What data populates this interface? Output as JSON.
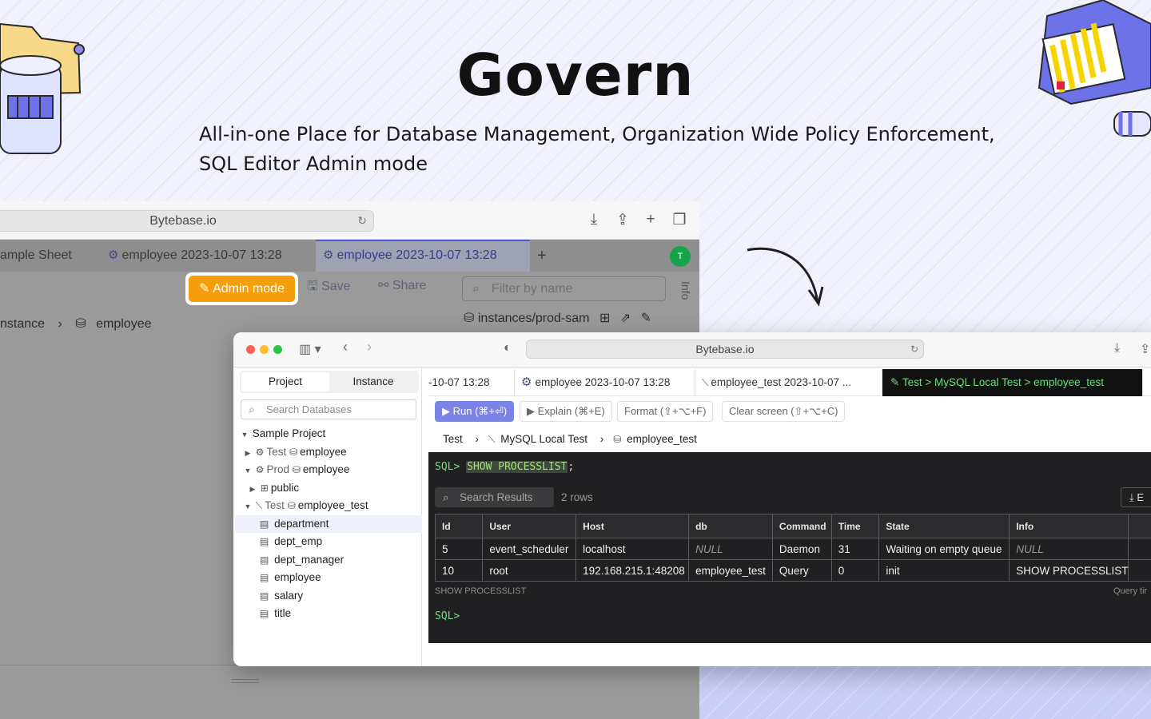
{
  "hero": {
    "title": "Govern",
    "subtitle": "All-in-one Place for Database Management, Organization Wide Policy Enforcement, SQL Editor Admin mode"
  },
  "colors": {
    "accent": "#4f5bd5",
    "admin_orange": "#f59e0b",
    "console_green": "#6fe081",
    "brand_purple": "#7b83e6"
  },
  "back_window": {
    "url": "Bytebase.io",
    "tabs": [
      "ample Sheet",
      "employee 2023-10-07 13:28",
      "employee 2023-10-07 13:28"
    ],
    "avatar": "T",
    "admin_mode_label": "Admin mode",
    "save_label": "Save",
    "share_label": "Share",
    "filter_placeholder": "Filter by name",
    "info_label": "Info",
    "instance_path": "instances/prod-sam",
    "breadcrumb": [
      "nstance",
      "employee"
    ]
  },
  "front_window": {
    "url": "Bytebase.io",
    "sidebar": {
      "tabs": [
        "Project",
        "Instance"
      ],
      "search_placeholder": "Search Databases",
      "project": "Sample Project",
      "rows": [
        {
          "env": "Test",
          "db": "employee"
        },
        {
          "env": "Prod",
          "db": "employee"
        },
        {
          "schema": "public"
        },
        {
          "env": "Test",
          "db": "employee_test"
        }
      ],
      "tables": [
        "department",
        "dept_emp",
        "dept_manager",
        "employee",
        "salary",
        "title"
      ]
    },
    "tabs": [
      "-10-07 13:28",
      "employee 2023-10-07 13:28",
      "employee_test 2023-10-07 ...",
      "Test > MySQL Local Test > employee_test"
    ],
    "actions": {
      "run": "Run (⌘+⏎)",
      "explain": "Explain (⌘+E)",
      "format": "Format (⇧+⌥+F)",
      "clear": "Clear screen (⇧+⌥+C)"
    },
    "breadcrumb": [
      "Test",
      "MySQL Local Test",
      "employee_test"
    ],
    "console": {
      "prompt": "SQL>",
      "command": "SHOW PROCESSLIST",
      "semicolon": ";",
      "search_placeholder": "Search Results",
      "row_count": "2 rows",
      "export_label": "E",
      "columns": [
        "Id",
        "User",
        "Host",
        "db",
        "Command",
        "Time",
        "State",
        "Info"
      ],
      "rows": [
        [
          "5",
          "event_scheduler",
          "localhost",
          "NULL",
          "Daemon",
          "31",
          "Waiting on empty queue",
          "NULL"
        ],
        [
          "10",
          "root",
          "192.168.215.1:48208",
          "employee_test",
          "Query",
          "0",
          "init",
          "SHOW PROCESSLIST"
        ]
      ],
      "footer_statement": "SHOW PROCESSLIST",
      "footer_time": "Query tir"
    }
  }
}
